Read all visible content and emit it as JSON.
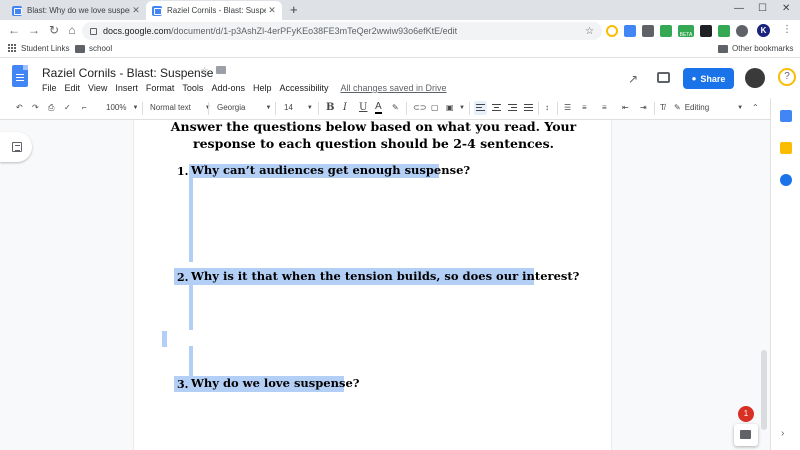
{
  "tabs": [
    {
      "title": "Blast: Why do we love suspense?",
      "icon": "google-classroom-icon"
    },
    {
      "title": "Raziel Cornils - Blast: Suspense",
      "icon": "google-docs-icon"
    }
  ],
  "address": {
    "host": "docs.google.com",
    "path": "/document/d/1-p3AshZl-4erPFyKEo38FE3mTeQer2wwiw93o6efKtE/edit"
  },
  "bookmarks": {
    "items": [
      "Student Links",
      "school"
    ],
    "other": "Other bookmarks"
  },
  "extension_badge": "BETA",
  "profile_initial": "K",
  "doc": {
    "title": "Raziel Cornils - Blast: Suspense",
    "menus": [
      "File",
      "Edit",
      "View",
      "Insert",
      "Format",
      "Tools",
      "Add-ons",
      "Help",
      "Accessibility"
    ],
    "saved_status": "All changes saved in Drive",
    "share_label": "Share"
  },
  "toolbar": {
    "zoom": "100%",
    "style": "Normal text",
    "font": "Georgia",
    "size": "14",
    "mode": "Editing"
  },
  "content": {
    "intro_line1": "Answer the questions below based on what you read. Your",
    "intro_line2": "response to each question should be 2-4 sentences.",
    "questions": [
      {
        "num": "1.",
        "text": "Why can’t audiences get enough suspense?"
      },
      {
        "num": "2.",
        "text": "Why is it that when the tension builds, so does our interest?"
      },
      {
        "num": "3.",
        "text": "Why do we love suspense?"
      }
    ]
  },
  "notification_count": "1",
  "colors": {
    "accent": "#1a73e8",
    "selection": "#b4cff5",
    "docs_blue": "#4285f4"
  }
}
